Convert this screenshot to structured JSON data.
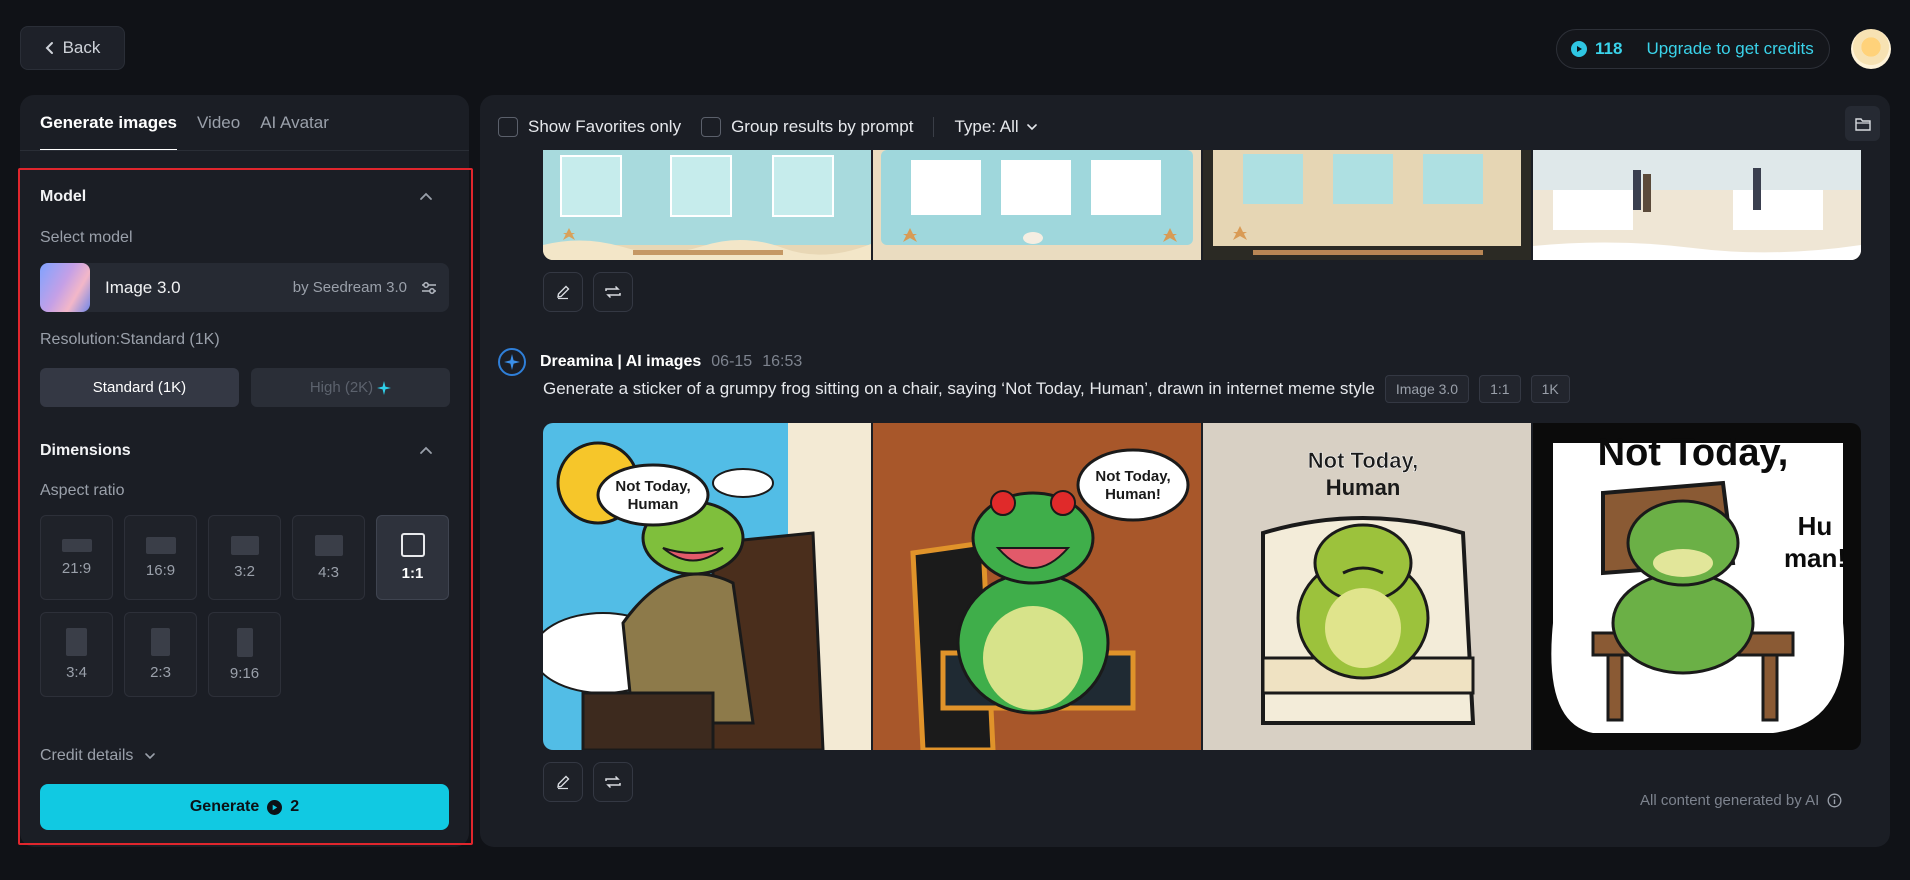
{
  "topbar": {
    "back_label": "Back",
    "credits_count": "118",
    "upgrade_label": "Upgrade to get credits"
  },
  "left": {
    "tabs": [
      {
        "label": "Generate images",
        "active": true
      },
      {
        "label": "Video",
        "active": false
      },
      {
        "label": "AI Avatar",
        "active": false
      }
    ],
    "model_section": {
      "title": "Model",
      "select_label": "Select model",
      "model_name": "Image 3.0",
      "model_by": "by Seedream 3.0"
    },
    "resolution": {
      "label": "Resolution:Standard (1K)",
      "standard": "Standard (1K)",
      "high": "High (2K)"
    },
    "dimensions": {
      "title": "Dimensions",
      "aspect_label": "Aspect ratio",
      "ratios": [
        "21:9",
        "16:9",
        "3:2",
        "4:3",
        "1:1",
        "3:4",
        "2:3",
        "9:16"
      ],
      "selected": "1:1"
    },
    "credit_details": "Credit details",
    "generate_label": "Generate",
    "generate_cost": "2"
  },
  "right": {
    "filters": {
      "favorites": "Show Favorites only",
      "group": "Group results by prompt",
      "type": "Type: All"
    },
    "generation": {
      "source": "Dreamina | AI images",
      "date": "06-15",
      "time": "16:53",
      "prompt": "Generate a sticker of a grumpy frog sitting on a chair, saying ‘Not Today, Human’, drawn in internet meme style",
      "tags": [
        "Image 3.0",
        "1:1",
        "1K"
      ],
      "image_captions": [
        "Not Today, Human",
        "Not Today, Human!",
        "Not Today, Human",
        "Not Today, Hu man!"
      ]
    },
    "footer_note": "All content generated by AI"
  },
  "icons": {
    "back": "chevron-left-icon",
    "credit": "credit-coin-icon",
    "collapse": "chevron-up-icon",
    "settings": "sliders-icon",
    "sparkle": "sparkle-icon",
    "edit": "pencil-icon",
    "regenerate": "repeat-icon",
    "folder": "folder-icon",
    "info": "info-icon"
  },
  "colors": {
    "accent": "#11c9e2",
    "highlight": "#e0262d",
    "panel": "#1b1e25",
    "background": "#101217"
  }
}
